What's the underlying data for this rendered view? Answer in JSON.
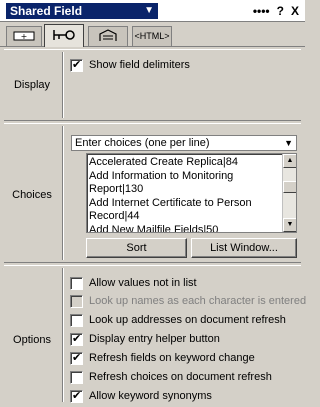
{
  "title_bar": {
    "field_type": "Shared Field",
    "icons": [
      "minimize-icon",
      "help-icon",
      "close-icon"
    ],
    "help_label": "?",
    "close_label": "X"
  },
  "tabs": [
    {
      "name": "basics-tab",
      "label": ""
    },
    {
      "name": "control-tab",
      "label": ""
    },
    {
      "name": "hide-when-tab",
      "label": ""
    },
    {
      "name": "html-tab",
      "label": "<HTML>"
    }
  ],
  "display": {
    "label": "Display",
    "show_delimiters": {
      "label": "Show field delimiters",
      "checked": true
    }
  },
  "choices": {
    "label": "Choices",
    "mode_selected": "Enter choices (one per line)",
    "list": [
      "Accelerated Create Replica|84",
      "Add Information to Monitoring",
      "Report|130",
      "Add Internet Certificate to Person",
      "Record|44",
      "Add New Mailfile Fields|50"
    ],
    "sort_label": "Sort",
    "list_window_label": "List Window..."
  },
  "options": {
    "label": "Options",
    "items": [
      {
        "label": "Allow values not in list",
        "checked": false,
        "disabled": false
      },
      {
        "label": "Look up names as each character is entered",
        "checked": false,
        "disabled": true
      },
      {
        "label": "Look up addresses on document refresh",
        "checked": false,
        "disabled": false
      },
      {
        "label": "Display entry helper button",
        "checked": true,
        "disabled": false
      },
      {
        "label": "Refresh fields on keyword change",
        "checked": true,
        "disabled": false
      },
      {
        "label": "Refresh choices on document refresh",
        "checked": false,
        "disabled": false
      },
      {
        "label": "Allow keyword synonyms",
        "checked": true,
        "disabled": false
      }
    ]
  }
}
